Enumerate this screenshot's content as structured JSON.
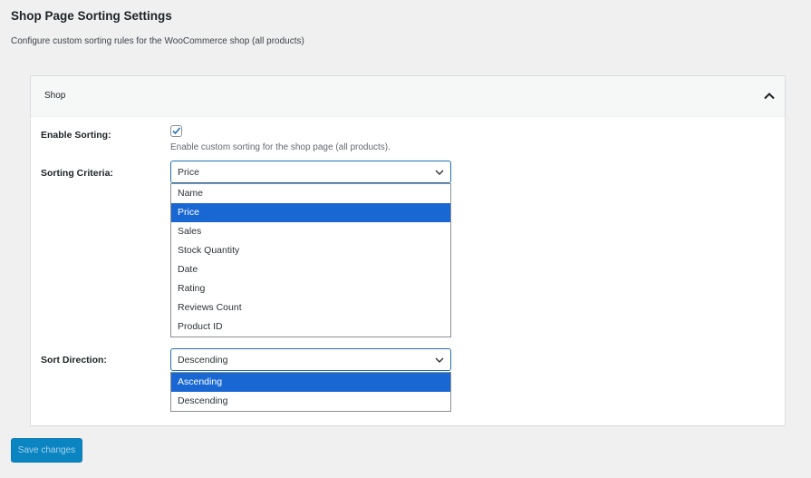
{
  "page": {
    "title": "Shop Page Sorting Settings",
    "subtitle": "Configure custom sorting rules for the WooCommerce shop (all products)"
  },
  "panel": {
    "title": "Shop",
    "enable": {
      "label": "Enable Sorting:",
      "checked": true,
      "description": "Enable custom sorting for the shop page (all products)."
    },
    "criteria": {
      "label": "Sorting Criteria:",
      "value": "Price",
      "options": [
        "Name",
        "Price",
        "Sales",
        "Stock Quantity",
        "Date",
        "Rating",
        "Reviews Count",
        "Product ID"
      ],
      "highlighted": "Price"
    },
    "direction": {
      "label": "Sort Direction:",
      "value": "Descending",
      "options": [
        "Ascending",
        "Descending"
      ],
      "highlighted": "Ascending"
    }
  },
  "save_label": "Save changes",
  "colors": {
    "accent": "#1967d2",
    "button": "#0a85c2"
  }
}
